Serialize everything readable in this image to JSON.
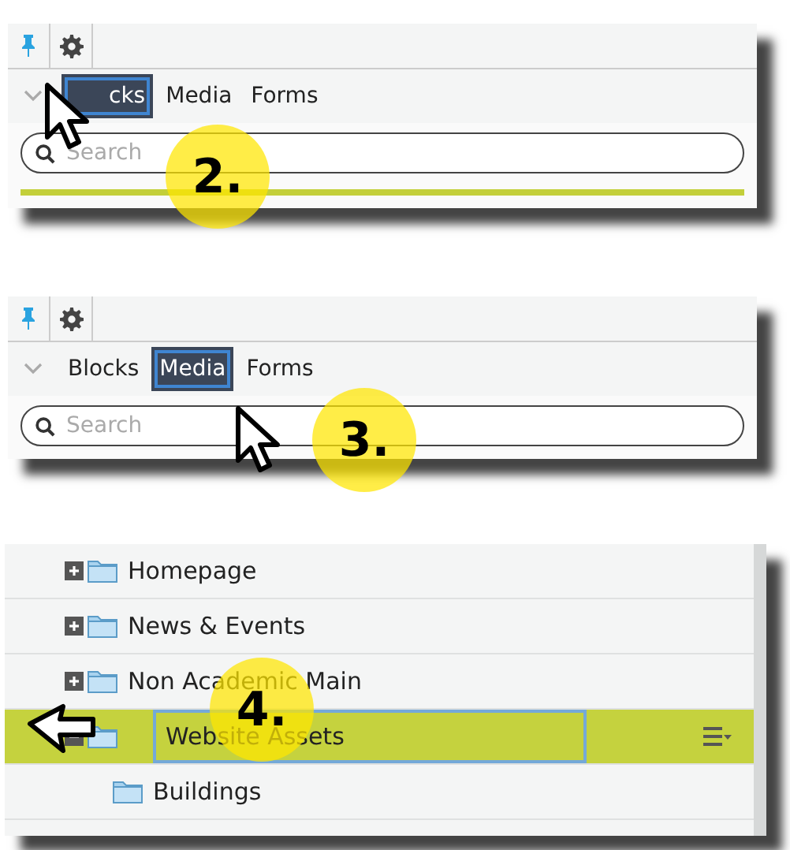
{
  "panels": [
    {
      "kind": "toolbar",
      "step": "2.",
      "pinned": true,
      "tabs": [
        {
          "label": "cks",
          "selected": true
        },
        {
          "label": "Media",
          "selected": false
        },
        {
          "label": "Forms",
          "selected": false
        }
      ],
      "search": {
        "placeholder": "Search"
      }
    },
    {
      "kind": "toolbar",
      "step": "3.",
      "pinned": true,
      "tabs": [
        {
          "label": "Blocks",
          "selected": false
        },
        {
          "label": "Media",
          "selected": true
        },
        {
          "label": "Forms",
          "selected": false
        }
      ],
      "search": {
        "placeholder": "Search"
      }
    },
    {
      "kind": "tree",
      "step": "4.",
      "rows": [
        {
          "label": "Homepage",
          "expanded": false,
          "selected": false
        },
        {
          "label": "News & Events",
          "expanded": false,
          "selected": false
        },
        {
          "label": "Non Academic Main",
          "expanded": false,
          "selected": false
        },
        {
          "label": "Website Assets",
          "expanded": true,
          "selected": true,
          "children": [
            {
              "label": "Buildings",
              "selected": false
            }
          ]
        }
      ]
    }
  ]
}
